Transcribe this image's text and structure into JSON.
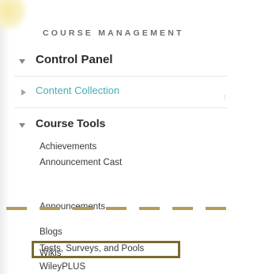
{
  "sidebar": {
    "heading": "COURSE MANAGEMENT",
    "control_panel": {
      "label": "Control Panel",
      "expanded": true
    },
    "content_collection": {
      "label": "Content Collection",
      "expanded": false,
      "color": "#46aeb3"
    },
    "course_tools": {
      "label": "Course Tools",
      "expanded": true,
      "items": [
        {
          "label": "Achievements"
        },
        {
          "label": "Announcement Cast"
        },
        {
          "label": "Announcements"
        },
        {
          "label": "Blogs"
        },
        {
          "label": "Tests, Surveys, and Pools",
          "highlighted": true
        },
        {
          "label": "Wikis"
        },
        {
          "label": "WileyPLUS"
        }
      ]
    }
  },
  "colors": {
    "highlight_border": "#7b6a30",
    "dashed_line": "#b59c57"
  }
}
